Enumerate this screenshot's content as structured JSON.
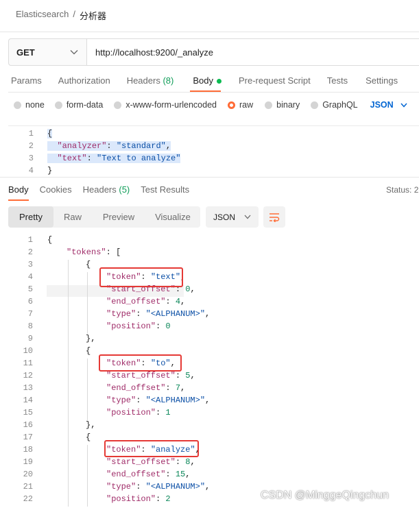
{
  "breadcrumb": {
    "collection": "Elasticsearch",
    "separator": "/",
    "request": "分析器"
  },
  "request": {
    "method": "GET",
    "url": "http://localhost:9200/_analyze"
  },
  "request_tabs": {
    "params": "Params",
    "authorization": "Authorization",
    "headers": "Headers",
    "headers_count": "(8)",
    "body": "Body",
    "prerequest": "Pre-request Script",
    "tests": "Tests",
    "settings": "Settings"
  },
  "body_types": {
    "none": "none",
    "form_data": "form-data",
    "urlencoded": "x-www-form-urlencoded",
    "raw": "raw",
    "binary": "binary",
    "graphql": "GraphQL",
    "format": "JSON",
    "selected": "raw"
  },
  "request_body": {
    "numbers": [
      "1",
      "2",
      "3",
      "4"
    ],
    "lines": {
      "l1": "{",
      "l2_key": "\"analyzer\"",
      "l2_val": "\"standard\"",
      "l3_key": "\"text\"",
      "l3_val": "\"Text to analyze\"",
      "l4": "}"
    }
  },
  "response_tabs": {
    "body": "Body",
    "cookies": "Cookies",
    "headers": "Headers",
    "headers_count": "(5)",
    "test_results": "Test Results",
    "status": "Status: 2"
  },
  "view_modes": {
    "pretty": "Pretty",
    "raw": "Raw",
    "preview": "Preview",
    "visualize": "Visualize",
    "format": "JSON"
  },
  "response_lines": [
    {
      "n": "1",
      "t": "{"
    },
    {
      "n": "2",
      "k": "\"tokens\"",
      "t": ": ["
    },
    {
      "n": "3",
      "t": "{"
    },
    {
      "n": "4",
      "k": "\"token\"",
      "s": "\"text\""
    },
    {
      "n": "5",
      "k": "\"start_offset\"",
      "v": "0"
    },
    {
      "n": "6",
      "k": "\"end_offset\"",
      "v": "4"
    },
    {
      "n": "7",
      "k": "\"type\"",
      "s": "\"<ALPHANUM>\""
    },
    {
      "n": "8",
      "k": "\"position\"",
      "v": "0"
    },
    {
      "n": "9",
      "t": "},"
    },
    {
      "n": "10",
      "t": "{"
    },
    {
      "n": "11",
      "k": "\"token\"",
      "s": "\"to\""
    },
    {
      "n": "12",
      "k": "\"start_offset\"",
      "v": "5"
    },
    {
      "n": "13",
      "k": "\"end_offset\"",
      "v": "7"
    },
    {
      "n": "14",
      "k": "\"type\"",
      "s": "\"<ALPHANUM>\""
    },
    {
      "n": "15",
      "k": "\"position\"",
      "v": "1"
    },
    {
      "n": "16",
      "t": "},"
    },
    {
      "n": "17",
      "t": "{"
    },
    {
      "n": "18",
      "k": "\"token\"",
      "s": "\"analyze\""
    },
    {
      "n": "19",
      "k": "\"start_offset\"",
      "v": "8"
    },
    {
      "n": "20",
      "k": "\"end_offset\"",
      "v": "15"
    },
    {
      "n": "21",
      "k": "\"type\"",
      "s": "\"<ALPHANUM>\""
    },
    {
      "n": "22",
      "k": "\"position\"",
      "v": "2"
    }
  ],
  "watermark": "CSDN @MinggeQingchun",
  "colors": {
    "accent": "#ff6c37",
    "json_key": "#9f2b68",
    "json_string": "#0b4fa6",
    "json_number": "#098658",
    "highlight_box": "#e53935"
  }
}
